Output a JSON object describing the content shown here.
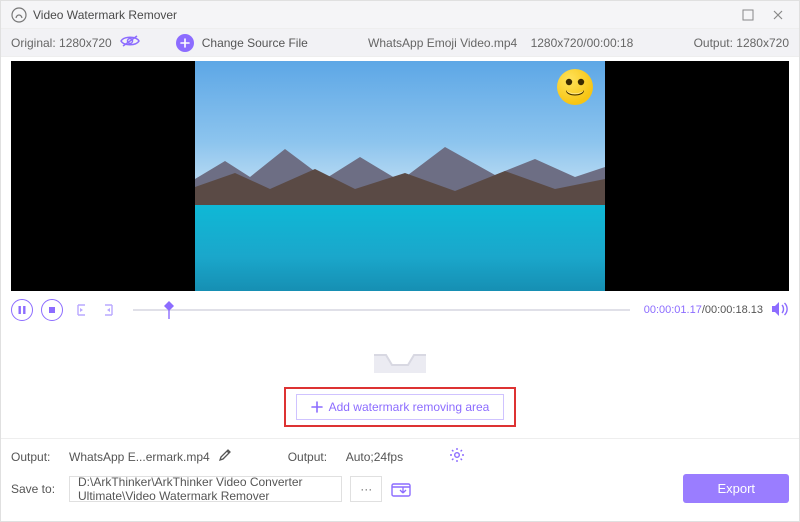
{
  "titlebar": {
    "title": "Video Watermark Remover"
  },
  "infobar": {
    "original": "Original: 1280x720",
    "change": "Change Source File",
    "filename": "WhatsApp Emoji Video.mp4",
    "srcres": "1280x720",
    "srcdur": "00:00:18",
    "output": "Output: 1280x720"
  },
  "player": {
    "current": "00:00:01.17",
    "duration": "/00:00:18.13"
  },
  "mid": {
    "add_area": "Add watermark removing area"
  },
  "bottom": {
    "output_label": "Output:",
    "output_file": "WhatsApp E...ermark.mp4",
    "fmt_label": "Output:",
    "fmt_value": "Auto;24fps",
    "save_label": "Save to:",
    "save_path": "D:\\ArkThinker\\ArkThinker Video Converter Ultimate\\Video Watermark Remover",
    "dots": "···",
    "export": "Export"
  }
}
